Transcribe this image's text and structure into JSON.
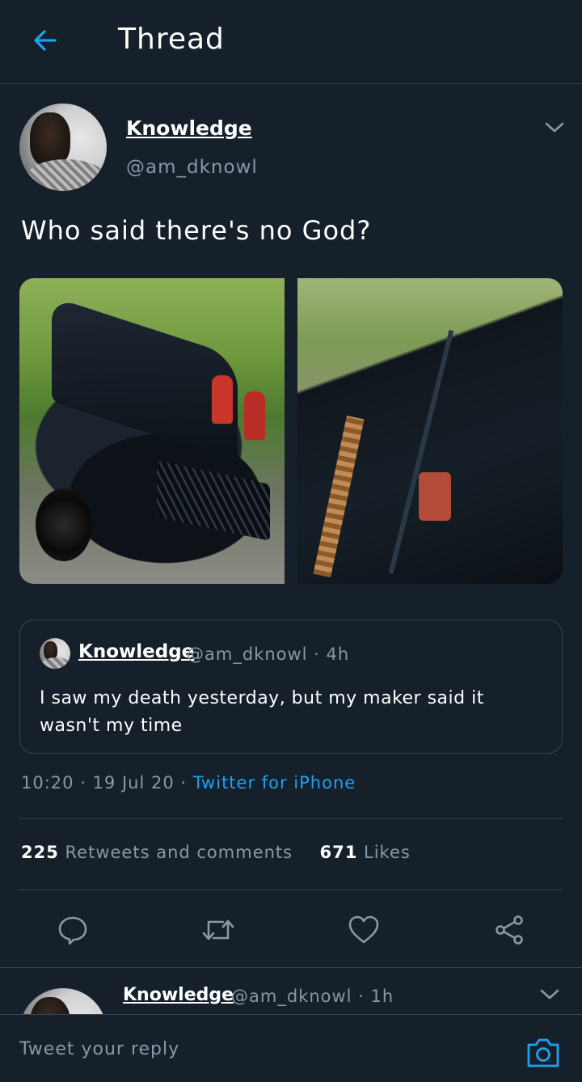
{
  "header": {
    "title": "Thread"
  },
  "tweet": {
    "author_name": "Knowledge",
    "author_handle": "@am_dknowl",
    "text": "Who said there's no God?",
    "quoted": {
      "author_name": "Knowledge",
      "meta": "@am_dknowl · 4h",
      "text": "I saw my death yesterday, but my maker said it wasn't my time"
    },
    "timestamp": "10:20 · 19 Jul 20 · ",
    "source": "Twitter for iPhone",
    "retweets_count": "225",
    "retweets_label": "Retweets and comments",
    "likes_count": "671",
    "likes_label": "Likes"
  },
  "actions": {
    "reply_icon": "reply-icon",
    "retweet_icon": "retweet-icon",
    "like_icon": "heart-icon",
    "share_icon": "share-icon"
  },
  "reply_preview": {
    "author_name": "Knowledge",
    "meta": "@am_dknowl · 1h"
  },
  "composer": {
    "placeholder": "Tweet your reply"
  },
  "colors": {
    "background": "#15202b",
    "accent": "#1da1f2",
    "secondary_text": "#8899a6",
    "border": "#38444d"
  }
}
